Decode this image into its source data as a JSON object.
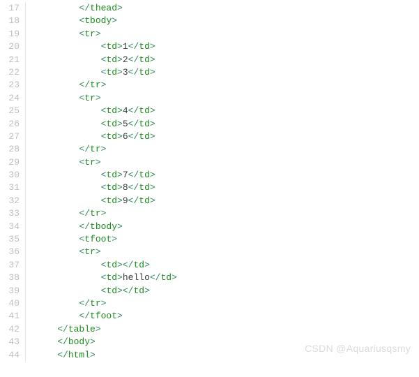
{
  "watermark": "CSDN @Aquariusqsmy",
  "lines": [
    {
      "num": 17,
      "indent": 8,
      "tokens": [
        {
          "t": "</",
          "c": "p"
        },
        {
          "t": "thead",
          "c": "nm"
        },
        {
          "t": ">",
          "c": "p"
        }
      ]
    },
    {
      "num": 18,
      "indent": 8,
      "tokens": [
        {
          "t": "<",
          "c": "p"
        },
        {
          "t": "tbody",
          "c": "nm"
        },
        {
          "t": ">",
          "c": "p"
        }
      ]
    },
    {
      "num": 19,
      "indent": 8,
      "tokens": [
        {
          "t": "<",
          "c": "p"
        },
        {
          "t": "tr",
          "c": "nm"
        },
        {
          "t": ">",
          "c": "p"
        }
      ]
    },
    {
      "num": 20,
      "indent": 12,
      "tokens": [
        {
          "t": "<",
          "c": "p"
        },
        {
          "t": "td",
          "c": "nm"
        },
        {
          "t": ">",
          "c": "p"
        },
        {
          "t": "1",
          "c": "txt"
        },
        {
          "t": "</",
          "c": "p"
        },
        {
          "t": "td",
          "c": "nm"
        },
        {
          "t": ">",
          "c": "p"
        }
      ]
    },
    {
      "num": 21,
      "indent": 12,
      "tokens": [
        {
          "t": "<",
          "c": "p"
        },
        {
          "t": "td",
          "c": "nm"
        },
        {
          "t": ">",
          "c": "p"
        },
        {
          "t": "2",
          "c": "txt"
        },
        {
          "t": "</",
          "c": "p"
        },
        {
          "t": "td",
          "c": "nm"
        },
        {
          "t": ">",
          "c": "p"
        }
      ]
    },
    {
      "num": 22,
      "indent": 12,
      "tokens": [
        {
          "t": "<",
          "c": "p"
        },
        {
          "t": "td",
          "c": "nm"
        },
        {
          "t": ">",
          "c": "p"
        },
        {
          "t": "3",
          "c": "txt"
        },
        {
          "t": "</",
          "c": "p"
        },
        {
          "t": "td",
          "c": "nm"
        },
        {
          "t": ">",
          "c": "p"
        }
      ]
    },
    {
      "num": 23,
      "indent": 8,
      "tokens": [
        {
          "t": "</",
          "c": "p"
        },
        {
          "t": "tr",
          "c": "nm"
        },
        {
          "t": ">",
          "c": "p"
        }
      ]
    },
    {
      "num": 24,
      "indent": 8,
      "tokens": [
        {
          "t": "<",
          "c": "p"
        },
        {
          "t": "tr",
          "c": "nm"
        },
        {
          "t": ">",
          "c": "p"
        }
      ]
    },
    {
      "num": 25,
      "indent": 12,
      "tokens": [
        {
          "t": "<",
          "c": "p"
        },
        {
          "t": "td",
          "c": "nm"
        },
        {
          "t": ">",
          "c": "p"
        },
        {
          "t": "4",
          "c": "txt"
        },
        {
          "t": "</",
          "c": "p"
        },
        {
          "t": "td",
          "c": "nm"
        },
        {
          "t": ">",
          "c": "p"
        }
      ]
    },
    {
      "num": 26,
      "indent": 12,
      "tokens": [
        {
          "t": "<",
          "c": "p"
        },
        {
          "t": "td",
          "c": "nm"
        },
        {
          "t": ">",
          "c": "p"
        },
        {
          "t": "5",
          "c": "txt"
        },
        {
          "t": "</",
          "c": "p"
        },
        {
          "t": "td",
          "c": "nm"
        },
        {
          "t": ">",
          "c": "p"
        }
      ]
    },
    {
      "num": 27,
      "indent": 12,
      "tokens": [
        {
          "t": "<",
          "c": "p"
        },
        {
          "t": "td",
          "c": "nm"
        },
        {
          "t": ">",
          "c": "p"
        },
        {
          "t": "6",
          "c": "txt"
        },
        {
          "t": "</",
          "c": "p"
        },
        {
          "t": "td",
          "c": "nm"
        },
        {
          "t": ">",
          "c": "p"
        }
      ]
    },
    {
      "num": 28,
      "indent": 8,
      "tokens": [
        {
          "t": "</",
          "c": "p"
        },
        {
          "t": "tr",
          "c": "nm"
        },
        {
          "t": ">",
          "c": "p"
        }
      ]
    },
    {
      "num": 29,
      "indent": 8,
      "tokens": [
        {
          "t": "<",
          "c": "p"
        },
        {
          "t": "tr",
          "c": "nm"
        },
        {
          "t": ">",
          "c": "p"
        }
      ]
    },
    {
      "num": 30,
      "indent": 12,
      "tokens": [
        {
          "t": "<",
          "c": "p"
        },
        {
          "t": "td",
          "c": "nm"
        },
        {
          "t": ">",
          "c": "p"
        },
        {
          "t": "7",
          "c": "txt"
        },
        {
          "t": "</",
          "c": "p"
        },
        {
          "t": "td",
          "c": "nm"
        },
        {
          "t": ">",
          "c": "p"
        }
      ]
    },
    {
      "num": 31,
      "indent": 12,
      "tokens": [
        {
          "t": "<",
          "c": "p"
        },
        {
          "t": "td",
          "c": "nm"
        },
        {
          "t": ">",
          "c": "p"
        },
        {
          "t": "8",
          "c": "txt"
        },
        {
          "t": "</",
          "c": "p"
        },
        {
          "t": "td",
          "c": "nm"
        },
        {
          "t": ">",
          "c": "p"
        }
      ]
    },
    {
      "num": 32,
      "indent": 12,
      "tokens": [
        {
          "t": "<",
          "c": "p"
        },
        {
          "t": "td",
          "c": "nm"
        },
        {
          "t": ">",
          "c": "p"
        },
        {
          "t": "9",
          "c": "txt"
        },
        {
          "t": "</",
          "c": "p"
        },
        {
          "t": "td",
          "c": "nm"
        },
        {
          "t": ">",
          "c": "p"
        }
      ]
    },
    {
      "num": 33,
      "indent": 8,
      "tokens": [
        {
          "t": "</",
          "c": "p"
        },
        {
          "t": "tr",
          "c": "nm"
        },
        {
          "t": ">",
          "c": "p"
        }
      ]
    },
    {
      "num": 34,
      "indent": 8,
      "tokens": [
        {
          "t": "</",
          "c": "p"
        },
        {
          "t": "tbody",
          "c": "nm"
        },
        {
          "t": ">",
          "c": "p"
        }
      ]
    },
    {
      "num": 35,
      "indent": 8,
      "tokens": [
        {
          "t": "<",
          "c": "p"
        },
        {
          "t": "tfoot",
          "c": "nm"
        },
        {
          "t": ">",
          "c": "p"
        }
      ]
    },
    {
      "num": 36,
      "indent": 8,
      "tokens": [
        {
          "t": "<",
          "c": "p"
        },
        {
          "t": "tr",
          "c": "nm"
        },
        {
          "t": ">",
          "c": "p"
        }
      ]
    },
    {
      "num": 37,
      "indent": 12,
      "tokens": [
        {
          "t": "<",
          "c": "p"
        },
        {
          "t": "td",
          "c": "nm"
        },
        {
          "t": ">",
          "c": "p"
        },
        {
          "t": "</",
          "c": "p"
        },
        {
          "t": "td",
          "c": "nm"
        },
        {
          "t": ">",
          "c": "p"
        }
      ]
    },
    {
      "num": 38,
      "indent": 12,
      "tokens": [
        {
          "t": "<",
          "c": "p"
        },
        {
          "t": "td",
          "c": "nm"
        },
        {
          "t": ">",
          "c": "p"
        },
        {
          "t": "hello",
          "c": "txt"
        },
        {
          "t": "</",
          "c": "p"
        },
        {
          "t": "td",
          "c": "nm"
        },
        {
          "t": ">",
          "c": "p"
        }
      ]
    },
    {
      "num": 39,
      "indent": 12,
      "tokens": [
        {
          "t": "<",
          "c": "p"
        },
        {
          "t": "td",
          "c": "nm"
        },
        {
          "t": ">",
          "c": "p"
        },
        {
          "t": "</",
          "c": "p"
        },
        {
          "t": "td",
          "c": "nm"
        },
        {
          "t": ">",
          "c": "p"
        }
      ]
    },
    {
      "num": 40,
      "indent": 8,
      "tokens": [
        {
          "t": "</",
          "c": "p"
        },
        {
          "t": "tr",
          "c": "nm"
        },
        {
          "t": ">",
          "c": "p"
        }
      ]
    },
    {
      "num": 41,
      "indent": 8,
      "tokens": [
        {
          "t": "</",
          "c": "p"
        },
        {
          "t": "tfoot",
          "c": "nm"
        },
        {
          "t": ">",
          "c": "p"
        }
      ]
    },
    {
      "num": 42,
      "indent": 4,
      "tokens": [
        {
          "t": "</",
          "c": "p"
        },
        {
          "t": "table",
          "c": "nm"
        },
        {
          "t": ">",
          "c": "p"
        }
      ]
    },
    {
      "num": 43,
      "indent": 4,
      "tokens": [
        {
          "t": "</",
          "c": "p"
        },
        {
          "t": "body",
          "c": "nm"
        },
        {
          "t": ">",
          "c": "p"
        }
      ]
    },
    {
      "num": 44,
      "indent": 4,
      "tokens": [
        {
          "t": "</",
          "c": "p"
        },
        {
          "t": "html",
          "c": "nm"
        },
        {
          "t": ">",
          "c": "p"
        }
      ]
    }
  ]
}
